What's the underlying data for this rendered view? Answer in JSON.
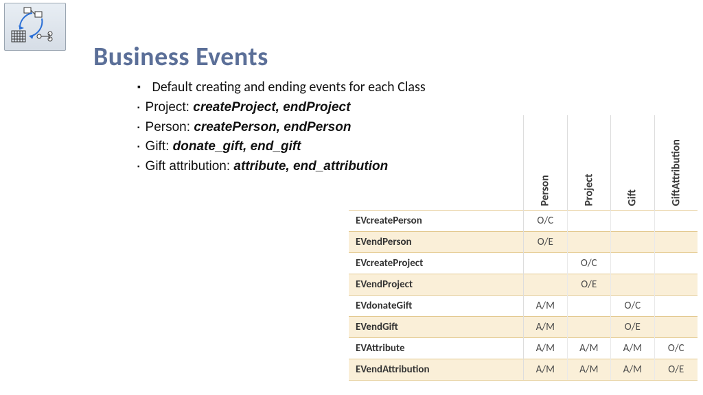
{
  "title": "Business Events",
  "main_bullet": "Default creating and ending events for each Class",
  "sub_bullets": [
    {
      "label": "Project:",
      "events": "createProject, endProject"
    },
    {
      "label": "Person:",
      "events": "createPerson, endPerson"
    },
    {
      "label": "Gift:",
      "events": "donate_gift, end_gift"
    },
    {
      "label": "Gift attribution:",
      "events": "attribute, end_attribution"
    }
  ],
  "table": {
    "columns": [
      "Person",
      "Project",
      "Gift",
      "GiftAttribution"
    ],
    "rows": [
      {
        "name": "EVcreatePerson",
        "cells": [
          "O/C",
          "",
          "",
          ""
        ]
      },
      {
        "name": "EVendPerson",
        "cells": [
          "O/E",
          "",
          "",
          ""
        ]
      },
      {
        "name": "EVcreateProject",
        "cells": [
          "",
          "O/C",
          "",
          ""
        ]
      },
      {
        "name": "EVendProject",
        "cells": [
          "",
          "O/E",
          "",
          ""
        ]
      },
      {
        "name": "EVdonateGift",
        "cells": [
          "A/M",
          "",
          "O/C",
          ""
        ]
      },
      {
        "name": "EVendGift",
        "cells": [
          "A/M",
          "",
          "O/E",
          ""
        ]
      },
      {
        "name": "EVAttribute",
        "cells": [
          "A/M",
          "A/M",
          "A/M",
          "O/C"
        ]
      },
      {
        "name": "EVendAttribution",
        "cells": [
          "A/M",
          "A/M",
          "A/M",
          "O/E"
        ]
      }
    ]
  }
}
